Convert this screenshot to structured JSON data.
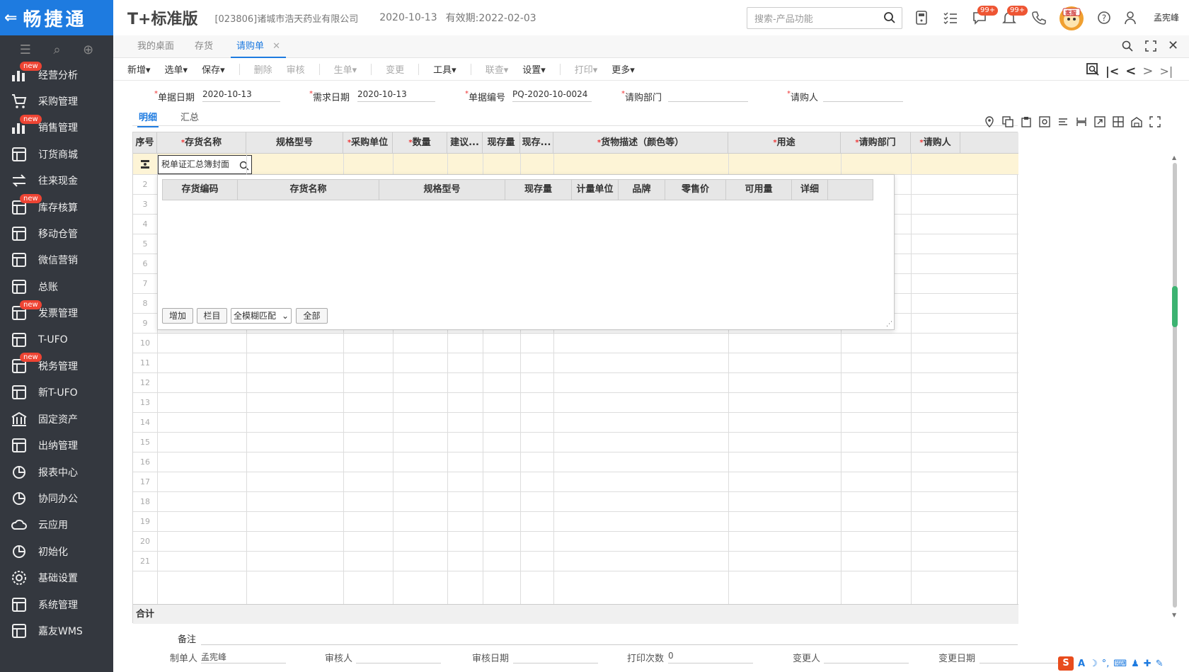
{
  "sidebar": {
    "brand": "畅捷通",
    "items": [
      {
        "label": "经营分析",
        "badge": "new",
        "icon": "analysis-icon"
      },
      {
        "label": "采购管理",
        "badge": "",
        "icon": "cart-icon"
      },
      {
        "label": "销售管理",
        "badge": "new",
        "icon": "sales-chart-icon"
      },
      {
        "label": "订货商城",
        "badge": "",
        "icon": "store-icon"
      },
      {
        "label": "往来现金",
        "badge": "",
        "icon": "exchange-icon"
      },
      {
        "label": "库存核算",
        "badge": "new",
        "icon": "inventory-icon"
      },
      {
        "label": "移动仓管",
        "badge": "",
        "icon": "mobile-warehouse-icon"
      },
      {
        "label": "微信营销",
        "badge": "",
        "icon": "wechat-icon"
      },
      {
        "label": "总账",
        "badge": "",
        "icon": "ledger-icon"
      },
      {
        "label": "发票管理",
        "badge": "new",
        "icon": "invoice-icon"
      },
      {
        "label": "T-UFO",
        "badge": "",
        "icon": "ufo-icon"
      },
      {
        "label": "税务管理",
        "badge": "new",
        "icon": "tax-icon"
      },
      {
        "label": "新T-UFO",
        "badge": "",
        "icon": "new-ufo-icon"
      },
      {
        "label": "固定资产",
        "badge": "",
        "icon": "bank-icon"
      },
      {
        "label": "出纳管理",
        "badge": "",
        "icon": "cashier-icon"
      },
      {
        "label": "报表中心",
        "badge": "",
        "icon": "pie-icon"
      },
      {
        "label": "协同办公",
        "badge": "",
        "icon": "collab-icon"
      },
      {
        "label": "云应用",
        "badge": "",
        "icon": "cloud-icon"
      },
      {
        "label": "初始化",
        "badge": "",
        "icon": "init-icon"
      },
      {
        "label": "基础设置",
        "badge": "",
        "icon": "settings-icon"
      },
      {
        "label": "系统管理",
        "badge": "",
        "icon": "system-icon"
      },
      {
        "label": "嘉友WMS",
        "badge": "",
        "icon": "wms-icon"
      }
    ]
  },
  "header": {
    "logo": "T+标准版",
    "company": "[023806]诸城市浩天药业有限公司",
    "date": "2020-10-13",
    "expiry": "有效期:2022-02-03",
    "search_placeholder": "搜索-产品功能",
    "badge1": "99+",
    "badge2": "99+",
    "service": "客服",
    "user": "孟宪峰"
  },
  "tabs": [
    "我的桌面",
    "存货",
    "请购单"
  ],
  "toolbar": [
    "新增▾",
    "选单▾",
    "保存▾",
    "删除",
    "审核",
    "生单▾",
    "变更",
    "工具▾",
    "联查▾",
    "设置▾",
    "打印▾",
    "更多▾"
  ],
  "form": {
    "doc_date_label": "单据日期",
    "doc_date": "2020-10-13",
    "need_date_label": "需求日期",
    "need_date": "2020-10-13",
    "doc_no_label": "单据编号",
    "doc_no": "PQ-2020-10-0024",
    "dept_label": "请购部门",
    "person_label": "请购人",
    "subtab_detail": "明细",
    "subtab_summary": "汇总"
  },
  "grid": {
    "columns": [
      "序号",
      "存货名称",
      "规格型号",
      "采购单位",
      "数量",
      "建议...",
      "现存量",
      "现存...",
      "货物描述（颜色等）",
      "用途",
      "请购部门",
      "请购人"
    ],
    "required": [
      false,
      true,
      false,
      true,
      true,
      false,
      false,
      false,
      true,
      true,
      true,
      true
    ],
    "edit_value": "税单证汇总簿封面",
    "rows": [
      "2",
      "3",
      "4",
      "5",
      "6",
      "7",
      "8",
      "9",
      "10",
      "11",
      "12",
      "13",
      "14",
      "15",
      "16",
      "17",
      "18",
      "19",
      "20",
      "21"
    ],
    "total_label": "合计"
  },
  "popup": {
    "columns": [
      "存货编码",
      "存货名称",
      "规格型号",
      "现存量",
      "计量单位",
      "品牌",
      "零售价",
      "可用量",
      "详细"
    ],
    "add": "增加",
    "columns_btn": "栏目",
    "match": "全模糊匹配",
    "all": "全部"
  },
  "footer": {
    "remark": "备注",
    "maker_label": "制单人",
    "maker": "孟宪峰",
    "auditor_label": "审核人",
    "audit_date_label": "审核日期",
    "print_count_label": "打印次数",
    "print_count": "0",
    "changer_label": "变更人",
    "change_date_label": "变更日期"
  }
}
